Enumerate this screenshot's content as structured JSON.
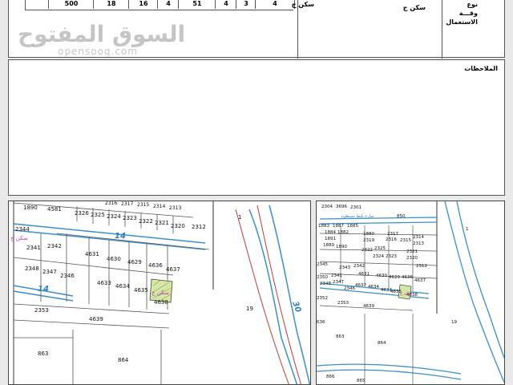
{
  "header": {
    "values": [
      "500",
      "18",
      "16",
      "4",
      "51",
      "4",
      "3",
      "4"
    ],
    "mid_label": "سكن ج",
    "mid_value": "سكن ج",
    "right_labels": [
      "نوع",
      "وقـــة",
      "الاستعمال"
    ]
  },
  "notes": {
    "label": "الملاحظات"
  },
  "watermark": {
    "arabic": "السوق المفتوح",
    "latin": "opensooq.com"
  },
  "map_left": {
    "parcels": [
      "1890",
      "4581",
      "2326",
      "2325",
      "2324",
      "2323",
      "2322",
      "2321",
      "2320",
      "2312",
      "2344",
      "2342",
      "2341",
      "4631",
      "4630",
      "4629",
      "4636",
      "4637",
      "2348",
      "2347",
      "2346",
      "4633",
      "4634",
      "4635",
      "4638",
      "2353",
      "4639",
      "863",
      "864",
      "19",
      "1"
    ],
    "street_labels": [
      "14",
      "14",
      "30"
    ],
    "zone_labels": [
      "سكن ج",
      "سكن ج"
    ],
    "top_labels": [
      "2316",
      "2317",
      "2315",
      "2314",
      "2313"
    ]
  },
  "map_right": {
    "parcels": [
      "2304",
      "3696",
      "2301",
      "850",
      "1883",
      "1887",
      "1885",
      "1884",
      "1882",
      "1880",
      "2317",
      "2316",
      "2315",
      "2314",
      "1891",
      "1889",
      "1890",
      "2319",
      "2313",
      "2322",
      "2325",
      "2320",
      "2323",
      "2324",
      "2321",
      "2312",
      "2345",
      "2343",
      "2342",
      "2341",
      "4631",
      "4630",
      "4629",
      "4636",
      "4637",
      "2350",
      "2348",
      "2347",
      "2346",
      "4632",
      "4634",
      "4633",
      "4635",
      "4638",
      "2352",
      "2353",
      "4639",
      "636",
      "863",
      "864",
      "19",
      "866",
      "865",
      "1"
    ],
    "street_labels": [
      "شارع بلنط مسطوية"
    ],
    "zone_labels": [
      "سكن ج"
    ]
  }
}
